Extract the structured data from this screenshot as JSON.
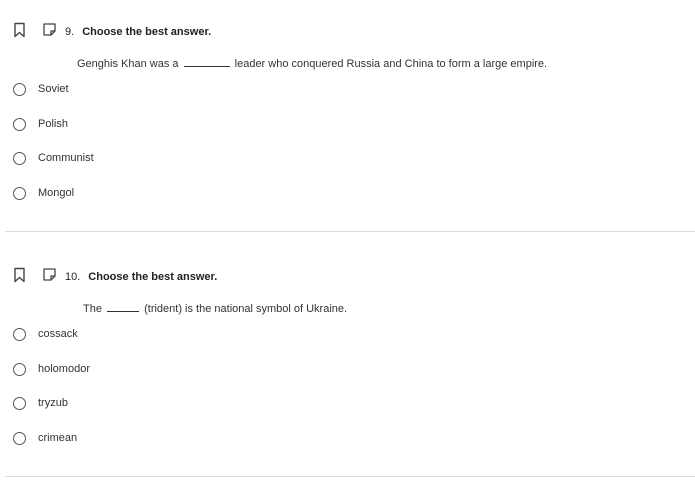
{
  "questions": [
    {
      "number": "9.",
      "instruction": "Choose the best answer.",
      "stem_before": "Genghis Khan was a",
      "stem_after": "leader who conquered Russia and China to form a large empire.",
      "options": [
        "Soviet",
        "Polish",
        "Communist",
        "Mongol"
      ]
    },
    {
      "number": "10.",
      "instruction": "Choose the best answer.",
      "stem_before": "The",
      "stem_after": "(trident) is the national symbol of Ukraine.",
      "options": [
        "cossack",
        "holomodor",
        "tryzub",
        "crimean"
      ]
    }
  ],
  "icons": {
    "bookmark": "bookmark-icon",
    "note": "note-icon"
  }
}
